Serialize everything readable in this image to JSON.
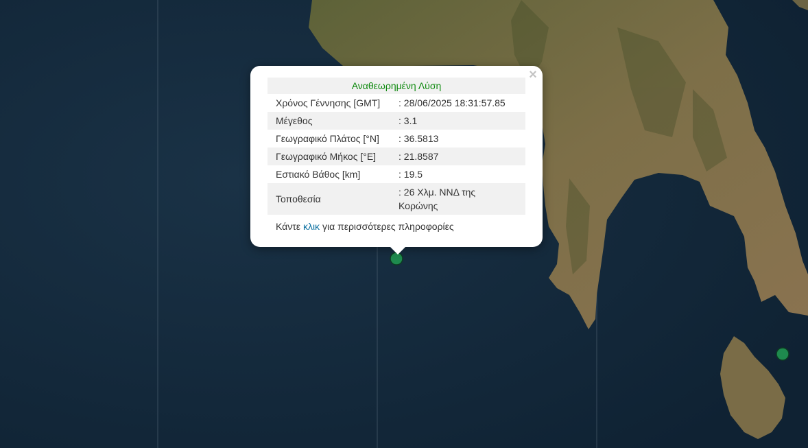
{
  "popup": {
    "title": "Αναθεωρημένη Λύση",
    "close_symbol": "×",
    "rows": [
      {
        "label": "Χρόνος Γέννησης [GMT]",
        "value": ": 28/06/2025 18:31:57.85"
      },
      {
        "label": "Μέγεθος",
        "value": ": 3.1"
      },
      {
        "label": "Γεωγραφικό Πλάτος [°N]",
        "value": ": 36.5813"
      },
      {
        "label": "Γεωγραφικό Μήκος [°E]",
        "value": ": 21.8587"
      },
      {
        "label": "Εστιακό Βάθος [km]",
        "value": ": 19.5"
      },
      {
        "label": "Τοποθεσία",
        "value": ": 26 Χλμ. ΝΝΔ της Κορώνης"
      }
    ],
    "more_prefix": "Κάντε",
    "more_link": "κλικ",
    "more_suffix": "για περισσότερες πληροφορίες"
  },
  "markers": [
    {
      "name": "selected-earthquake",
      "color": "#1e8a4e"
    },
    {
      "name": "earthquake",
      "color": "#1e8a4e"
    }
  ],
  "colors": {
    "sea": "#13283a",
    "land": "#6f6a44",
    "header_text": "#0f8a0f",
    "link": "#0a6fa0"
  }
}
